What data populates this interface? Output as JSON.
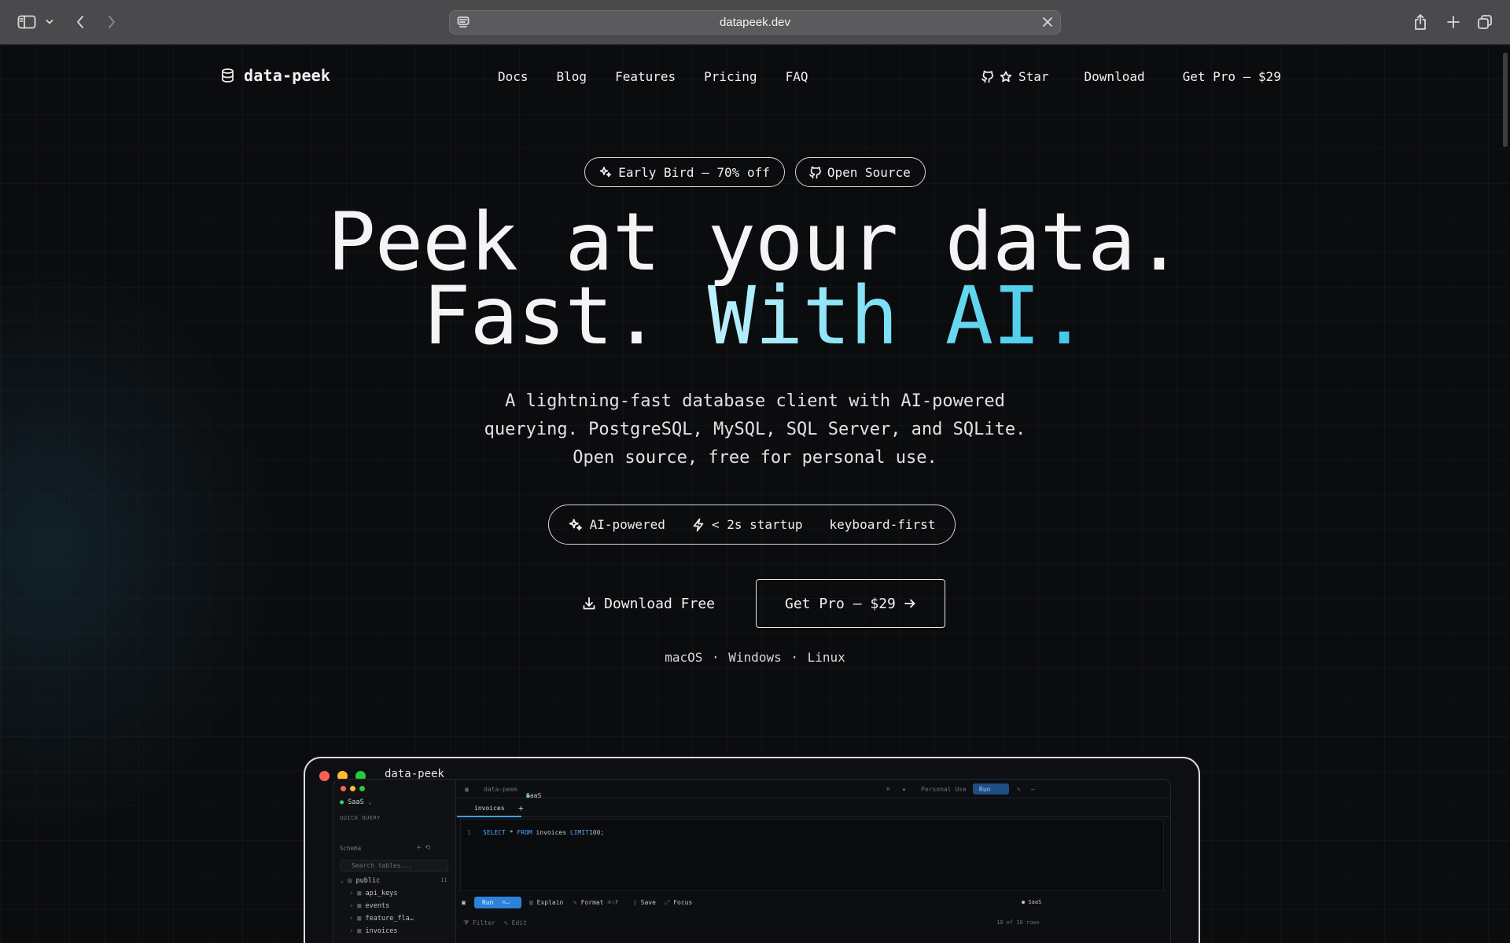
{
  "browser": {
    "url": "datapeek.dev"
  },
  "nav": {
    "logo": "data-peek",
    "links": [
      "Docs",
      "Blog",
      "Features",
      "Pricing",
      "FAQ"
    ],
    "star": "Star",
    "download": "Download",
    "get_pro": "Get Pro — $29"
  },
  "badges": {
    "early_bird": "Early Bird — 70% off",
    "open_source": "Open Source"
  },
  "hero": {
    "line1": "Peek at your data.",
    "line2_plain": "Fast.",
    "line2_accent": "With AI.",
    "subtitle_lines": [
      "A lightning-fast database client with AI-powered",
      "querying. PostgreSQL, MySQL, SQL Server, and SQLite.",
      "Open source, free for personal use."
    ],
    "features": [
      "AI-powered",
      "< 2s startup",
      "keyboard-first"
    ],
    "download_free": "Download Free",
    "get_pro": "Get Pro — $29",
    "platforms": "macOS · Windows · Linux"
  },
  "preview": {
    "window_title": "data-peek",
    "colors": {
      "close": "#ff5f57",
      "minimize": "#febc2e",
      "zoom": "#28c840",
      "accent": "#2b82d9"
    },
    "sidebar": {
      "connection": "SaaS",
      "quick_query": "QUICK QUERY",
      "schema": "Schema",
      "search_placeholder": "Search tables...",
      "schema_name": "public",
      "schema_count": "11",
      "tables": [
        "api_keys",
        "events",
        "feature_fla…",
        "invoices"
      ]
    },
    "topbar": {
      "crumb1": "data-peek",
      "crumb2": "SaaS",
      "license": "Personal Use",
      "run": "Run"
    },
    "tab": "invoices",
    "editor": {
      "line_number": "1",
      "kw_select": "SELECT",
      "star": "*",
      "kw_from": "FROM",
      "table": "invoices",
      "kw_limit": "LIMIT",
      "limit": "100",
      "end": ";"
    },
    "toolbar": {
      "run": "Run",
      "run_shortcut": "⌘↵",
      "explain": "Explain",
      "format": "Format",
      "format_shortcut": "⌘⇧F",
      "save": "Save",
      "focus": "Focus",
      "status": "● SaaS"
    },
    "results": {
      "filter": "Filter",
      "edit": "Edit",
      "count": "10 of 10 rows"
    }
  }
}
